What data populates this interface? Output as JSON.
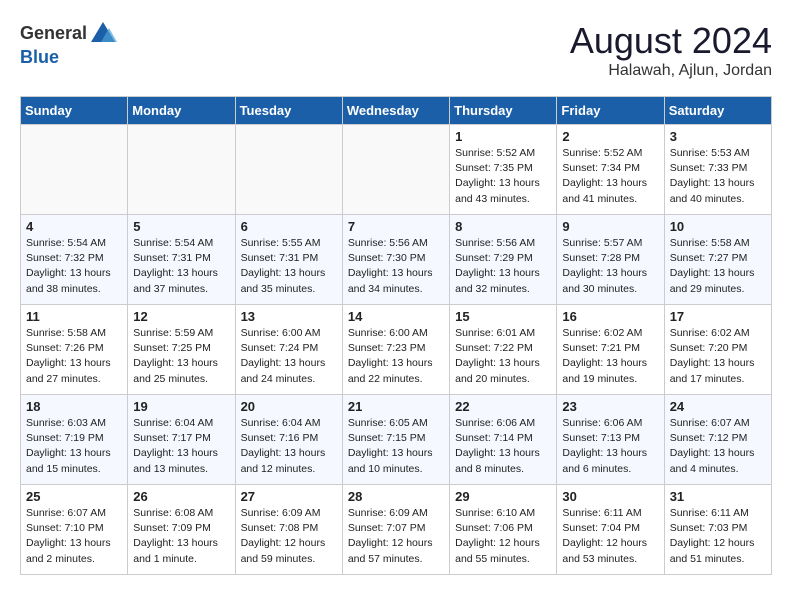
{
  "header": {
    "logo_general": "General",
    "logo_blue": "Blue",
    "month_title": "August 2024",
    "location": "Halawah, Ajlun, Jordan"
  },
  "weekdays": [
    "Sunday",
    "Monday",
    "Tuesday",
    "Wednesday",
    "Thursday",
    "Friday",
    "Saturday"
  ],
  "weeks": [
    [
      {
        "day": "",
        "detail": ""
      },
      {
        "day": "",
        "detail": ""
      },
      {
        "day": "",
        "detail": ""
      },
      {
        "day": "",
        "detail": ""
      },
      {
        "day": "1",
        "detail": "Sunrise: 5:52 AM\nSunset: 7:35 PM\nDaylight: 13 hours\nand 43 minutes."
      },
      {
        "day": "2",
        "detail": "Sunrise: 5:52 AM\nSunset: 7:34 PM\nDaylight: 13 hours\nand 41 minutes."
      },
      {
        "day": "3",
        "detail": "Sunrise: 5:53 AM\nSunset: 7:33 PM\nDaylight: 13 hours\nand 40 minutes."
      }
    ],
    [
      {
        "day": "4",
        "detail": "Sunrise: 5:54 AM\nSunset: 7:32 PM\nDaylight: 13 hours\nand 38 minutes."
      },
      {
        "day": "5",
        "detail": "Sunrise: 5:54 AM\nSunset: 7:31 PM\nDaylight: 13 hours\nand 37 minutes."
      },
      {
        "day": "6",
        "detail": "Sunrise: 5:55 AM\nSunset: 7:31 PM\nDaylight: 13 hours\nand 35 minutes."
      },
      {
        "day": "7",
        "detail": "Sunrise: 5:56 AM\nSunset: 7:30 PM\nDaylight: 13 hours\nand 34 minutes."
      },
      {
        "day": "8",
        "detail": "Sunrise: 5:56 AM\nSunset: 7:29 PM\nDaylight: 13 hours\nand 32 minutes."
      },
      {
        "day": "9",
        "detail": "Sunrise: 5:57 AM\nSunset: 7:28 PM\nDaylight: 13 hours\nand 30 minutes."
      },
      {
        "day": "10",
        "detail": "Sunrise: 5:58 AM\nSunset: 7:27 PM\nDaylight: 13 hours\nand 29 minutes."
      }
    ],
    [
      {
        "day": "11",
        "detail": "Sunrise: 5:58 AM\nSunset: 7:26 PM\nDaylight: 13 hours\nand 27 minutes."
      },
      {
        "day": "12",
        "detail": "Sunrise: 5:59 AM\nSunset: 7:25 PM\nDaylight: 13 hours\nand 25 minutes."
      },
      {
        "day": "13",
        "detail": "Sunrise: 6:00 AM\nSunset: 7:24 PM\nDaylight: 13 hours\nand 24 minutes."
      },
      {
        "day": "14",
        "detail": "Sunrise: 6:00 AM\nSunset: 7:23 PM\nDaylight: 13 hours\nand 22 minutes."
      },
      {
        "day": "15",
        "detail": "Sunrise: 6:01 AM\nSunset: 7:22 PM\nDaylight: 13 hours\nand 20 minutes."
      },
      {
        "day": "16",
        "detail": "Sunrise: 6:02 AM\nSunset: 7:21 PM\nDaylight: 13 hours\nand 19 minutes."
      },
      {
        "day": "17",
        "detail": "Sunrise: 6:02 AM\nSunset: 7:20 PM\nDaylight: 13 hours\nand 17 minutes."
      }
    ],
    [
      {
        "day": "18",
        "detail": "Sunrise: 6:03 AM\nSunset: 7:19 PM\nDaylight: 13 hours\nand 15 minutes."
      },
      {
        "day": "19",
        "detail": "Sunrise: 6:04 AM\nSunset: 7:17 PM\nDaylight: 13 hours\nand 13 minutes."
      },
      {
        "day": "20",
        "detail": "Sunrise: 6:04 AM\nSunset: 7:16 PM\nDaylight: 13 hours\nand 12 minutes."
      },
      {
        "day": "21",
        "detail": "Sunrise: 6:05 AM\nSunset: 7:15 PM\nDaylight: 13 hours\nand 10 minutes."
      },
      {
        "day": "22",
        "detail": "Sunrise: 6:06 AM\nSunset: 7:14 PM\nDaylight: 13 hours\nand 8 minutes."
      },
      {
        "day": "23",
        "detail": "Sunrise: 6:06 AM\nSunset: 7:13 PM\nDaylight: 13 hours\nand 6 minutes."
      },
      {
        "day": "24",
        "detail": "Sunrise: 6:07 AM\nSunset: 7:12 PM\nDaylight: 13 hours\nand 4 minutes."
      }
    ],
    [
      {
        "day": "25",
        "detail": "Sunrise: 6:07 AM\nSunset: 7:10 PM\nDaylight: 13 hours\nand 2 minutes."
      },
      {
        "day": "26",
        "detail": "Sunrise: 6:08 AM\nSunset: 7:09 PM\nDaylight: 13 hours\nand 1 minute."
      },
      {
        "day": "27",
        "detail": "Sunrise: 6:09 AM\nSunset: 7:08 PM\nDaylight: 12 hours\nand 59 minutes."
      },
      {
        "day": "28",
        "detail": "Sunrise: 6:09 AM\nSunset: 7:07 PM\nDaylight: 12 hours\nand 57 minutes."
      },
      {
        "day": "29",
        "detail": "Sunrise: 6:10 AM\nSunset: 7:06 PM\nDaylight: 12 hours\nand 55 minutes."
      },
      {
        "day": "30",
        "detail": "Sunrise: 6:11 AM\nSunset: 7:04 PM\nDaylight: 12 hours\nand 53 minutes."
      },
      {
        "day": "31",
        "detail": "Sunrise: 6:11 AM\nSunset: 7:03 PM\nDaylight: 12 hours\nand 51 minutes."
      }
    ]
  ]
}
